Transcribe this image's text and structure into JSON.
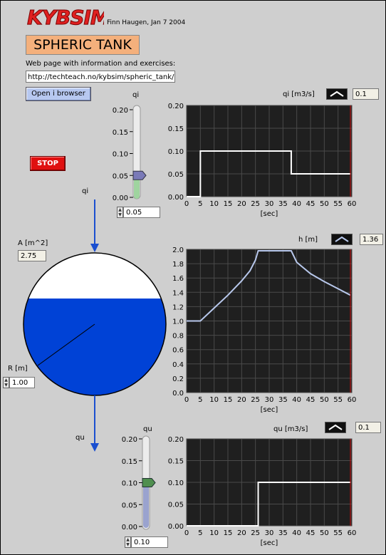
{
  "header": {
    "logo_text": "KYBSIM",
    "author": "Finn Haugen, Jan 7 2004",
    "title": "SPHERIC TANK",
    "web_label": "Web page with information and exercises:",
    "url": "http://techteach.no/kybsim/spheric_tank/",
    "open_button": "Open i browser"
  },
  "stop_button": "STOP",
  "inflow": {
    "arrow_label": "qi",
    "slider": {
      "label": "qi",
      "ticks": [
        "0.20",
        "0.15",
        "0.10",
        "0.05",
        "0.00"
      ],
      "value": 0.05,
      "display": "0.05",
      "max": 0.2,
      "fill_color": "#9fd49f",
      "knob_color": "#7a7ab8"
    }
  },
  "outflow": {
    "arrow_label": "qu",
    "slider": {
      "label": "qu",
      "ticks": [
        "0.20",
        "0.15",
        "0.10",
        "0.05",
        "0.00"
      ],
      "value": 0.1,
      "display": "0.10",
      "max": 0.2,
      "fill_color": "#9aa3cf",
      "knob_color": "#4f8f4f"
    }
  },
  "tank": {
    "area_label": "A [m^2]",
    "area_value": "2.75",
    "radius_label": "R [m]",
    "radius_value": "1.00",
    "level_fraction": 0.68,
    "water_color": "#0042d6"
  },
  "charts": {
    "qi": {
      "legend": "qi [m3/s]",
      "value": "0.1",
      "xlabel": "[sec]"
    },
    "h": {
      "legend": "h [m]",
      "value": "1.36",
      "xlabel": "[sec]"
    },
    "qu": {
      "legend": "qu [m3/s]",
      "value": "0.1",
      "xlabel": "[sec]"
    }
  },
  "chart_data": [
    {
      "type": "line",
      "title": "qi [m3/s]",
      "xlabel": "[sec]",
      "ylabel": "",
      "xlim": [
        0,
        60
      ],
      "ylim": [
        0,
        0.2
      ],
      "xticks": [
        "0",
        "5",
        "10",
        "15",
        "20",
        "25",
        "30",
        "35",
        "40",
        "45",
        "50",
        "55",
        "60"
      ],
      "yticks": [
        "0.00",
        "0.05",
        "0.10",
        "0.15",
        "0.20"
      ],
      "grid": true,
      "line_color": "#ffffff",
      "x": [
        0,
        2,
        2,
        4.9,
        5,
        5,
        38,
        38,
        60
      ],
      "y": [
        0,
        0,
        0,
        0,
        0,
        0.1,
        0.1,
        0.05,
        0.05
      ],
      "series": [
        {
          "x": [
            0,
            5,
            5,
            38,
            38,
            59.5
          ],
          "y": [
            0,
            0,
            0.1,
            0.1,
            0.05,
            0.05
          ]
        }
      ]
    },
    {
      "type": "line",
      "title": "h [m]",
      "xlabel": "[sec]",
      "ylabel": "",
      "xlim": [
        0,
        60
      ],
      "ylim": [
        0,
        2.0
      ],
      "xticks": [
        "0",
        "5",
        "10",
        "15",
        "20",
        "25",
        "30",
        "35",
        "40",
        "45",
        "50",
        "55",
        "60"
      ],
      "yticks": [
        "0.0",
        "0.2",
        "0.4",
        "0.6",
        "0.8",
        "1.0",
        "1.2",
        "1.4",
        "1.6",
        "1.8",
        "2.0"
      ],
      "grid": true,
      "line_color": "#b8c8ec",
      "series": [
        {
          "x": [
            0,
            5,
            10,
            15,
            20,
            23,
            25,
            26,
            30,
            35,
            38,
            40,
            45,
            50,
            55,
            59.5
          ],
          "y": [
            1.0,
            1.0,
            1.18,
            1.36,
            1.56,
            1.7,
            1.85,
            1.98,
            1.98,
            1.98,
            1.98,
            1.82,
            1.66,
            1.55,
            1.45,
            1.36
          ]
        }
      ]
    },
    {
      "type": "line",
      "title": "qu [m3/s]",
      "xlabel": "[sec]",
      "ylabel": "",
      "xlim": [
        0,
        60
      ],
      "ylim": [
        0,
        0.2
      ],
      "xticks": [
        "0",
        "5",
        "10",
        "15",
        "20",
        "25",
        "30",
        "35",
        "40",
        "45",
        "50",
        "55",
        "60"
      ],
      "yticks": [
        "0.00",
        "0.05",
        "0.10",
        "0.15",
        "0.20"
      ],
      "grid": true,
      "line_color": "#ffffff",
      "series": [
        {
          "x": [
            0,
            26,
            26,
            59.5
          ],
          "y": [
            0,
            0,
            0.1,
            0.1
          ]
        }
      ]
    }
  ]
}
